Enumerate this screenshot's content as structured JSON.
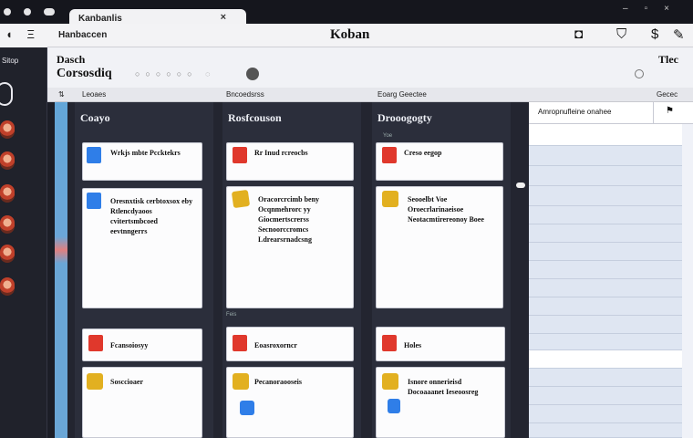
{
  "window": {
    "tab_label": "Kanbanlis",
    "tab_close": "×",
    "controls": "–▫×"
  },
  "toolbar": {
    "breadcrumb": "Hanbaccen",
    "title": "Koban",
    "menu_glyph": "Ξ"
  },
  "sidebar": {
    "header": "Sitop"
  },
  "board_header": {
    "line1": "Dasch",
    "line2": "Corsosdiq",
    "right_label": "Tlec"
  },
  "column_headers": [
    "Leoaes",
    "Bncoedsrss",
    "Eoarg Geectee",
    "Gecec"
  ],
  "columns": [
    {
      "title": "Coayo",
      "cards": [
        {
          "text": "Wrkjs mbte Pccktekrs",
          "chip": "blue"
        },
        {
          "text": "Oresnxtisk cerbtoxsox eby Rtlencdyaoos cvitertsmbcoed eevtnngerrs",
          "chip": "blue"
        },
        {
          "text": "Fcansoiosyy",
          "chip": "red"
        },
        {
          "text": "Sosccioaer",
          "chip": "yellow"
        }
      ]
    },
    {
      "title": "Rosfcouson",
      "cards": [
        {
          "text": "Rr Inud rcreocbs",
          "chip": "red"
        },
        {
          "text": "Oracorcrcimb beny Ocqnmehrorc yy Giocmertscrerss Secnoorccromcs Ldrearsrnadcsng",
          "chip": "yellow"
        },
        {
          "text": "Eoasroxorncr",
          "chip": "red"
        },
        {
          "text": "Pecanoraooseis",
          "chip": "yellow"
        }
      ]
    },
    {
      "title": "Drooogogty",
      "cards": [
        {
          "text": "Creso eegop",
          "chip": "red"
        },
        {
          "text": "Seooelbt Voe Oroecrlarinaeisoe Neotacmtirereonoy Boee",
          "chip": "yellow"
        },
        {
          "text": "Holes",
          "chip": "red"
        },
        {
          "text": "Isnore onnerieisd Docoaaanet Ieseoosreg",
          "chip": "yellow"
        }
      ]
    }
  ],
  "column_tags": [
    "Feis",
    "Yoe"
  ],
  "panel": {
    "header": "Amropnufleine onahee"
  },
  "colors": {
    "blue": "#2f7ee8",
    "red": "#e0382c",
    "yellow": "#e2b020"
  }
}
